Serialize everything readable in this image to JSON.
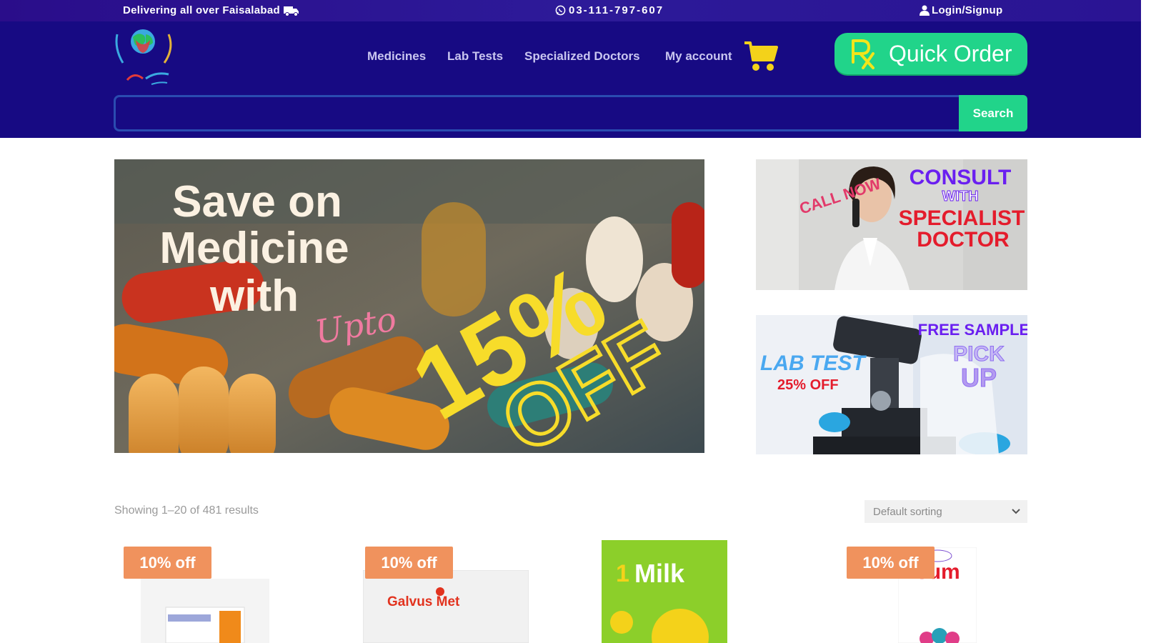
{
  "topbar": {
    "delivery_text": "Delivering all over Faisalabad",
    "phone": "03-111-797-607",
    "login": "Login/Signup"
  },
  "nav": {
    "items": [
      "Medicines",
      "Lab Tests",
      "Specialized Doctors",
      "My account"
    ]
  },
  "quick_order": {
    "label": "Quick Order"
  },
  "search": {
    "placeholder": "",
    "button": "Search"
  },
  "banner_main": {
    "line1": "Save on",
    "line2": "Medicine",
    "line3": "with",
    "upto": "Upto",
    "percent": "15%",
    "off": "OFF"
  },
  "banner_consult": {
    "call_now": "CALL NOW",
    "consult": "CONSULT",
    "with": "WITH",
    "specialist": "SPECIALIST",
    "doctor": "DOCTOR"
  },
  "banner_lab": {
    "lab_test": "LAB TEST",
    "discount": "25% OFF",
    "free_sample": "FREE SAMPLE",
    "pick": "PICK",
    "up": "UP"
  },
  "listing": {
    "results_text": "Showing 1–20 of 481 results",
    "sort_selected": "Default sorting"
  },
  "products": [
    {
      "badge": "10% off",
      "pack_text": ""
    },
    {
      "badge": "10% off",
      "pack_text": "Galvus Met"
    },
    {
      "badge": "",
      "pack_text": "Milk"
    },
    {
      "badge": "10% off",
      "pack_text": "Esum"
    }
  ],
  "colors": {
    "header_bg": "#170a83",
    "accent_green": "#21d48a",
    "badge_orange": "#f0925d"
  }
}
